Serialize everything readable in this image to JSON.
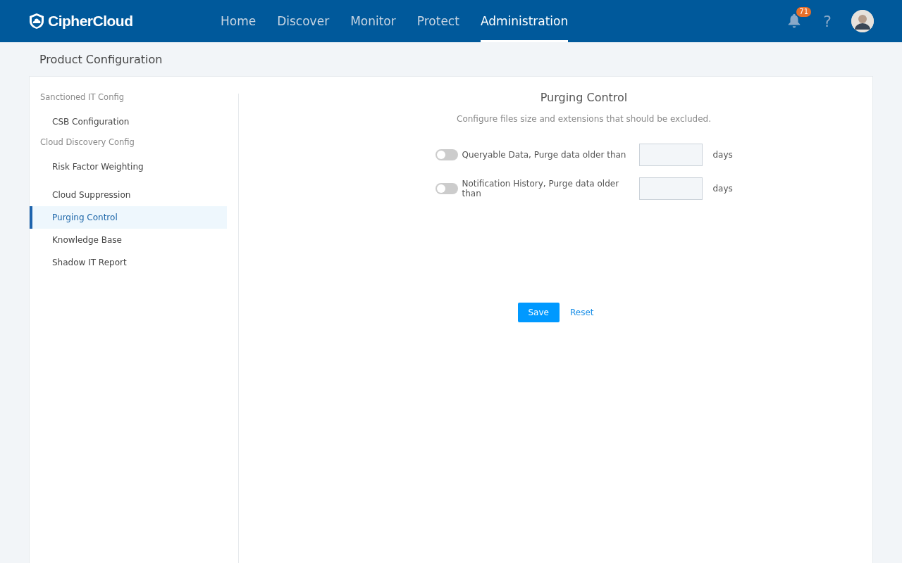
{
  "header": {
    "logo": "CipherCloud",
    "nav": [
      {
        "label": "Home",
        "selected": false
      },
      {
        "label": "Discover",
        "selected": false
      },
      {
        "label": "Monitor",
        "selected": false
      },
      {
        "label": "Protect",
        "selected": false
      },
      {
        "label": "Administration",
        "selected": true
      }
    ],
    "notifications": "71",
    "help": "?"
  },
  "page_title": "Product Configuration",
  "sidebar": {
    "sections": [
      {
        "title": "Sanctioned IT Config",
        "items": [
          {
            "label": "CSB Configuration",
            "selected": false
          }
        ]
      },
      {
        "title": "Cloud Discovery Config",
        "items": [
          {
            "label": "Risk Factor Weighting",
            "selected": false
          },
          {
            "label": "Cloud Suppression",
            "selected": false
          },
          {
            "label": "Purging Control",
            "selected": true
          },
          {
            "label": "Knowledge Base",
            "selected": false
          },
          {
            "label": "Shadow IT Report",
            "selected": false
          }
        ]
      }
    ]
  },
  "panel": {
    "title": "Purging Control",
    "description": "Configure files size and extensions that should be excluded.",
    "settings": [
      {
        "label": "Queryable Data, Purge data older than",
        "on": false,
        "unit": "days"
      },
      {
        "label": "Notification History, Purge data older than",
        "on": false,
        "unit": "days"
      }
    ],
    "buttons": [
      {
        "kind": "primary",
        "label": "Save"
      },
      {
        "kind": "link",
        "label": "Reset"
      }
    ]
  }
}
